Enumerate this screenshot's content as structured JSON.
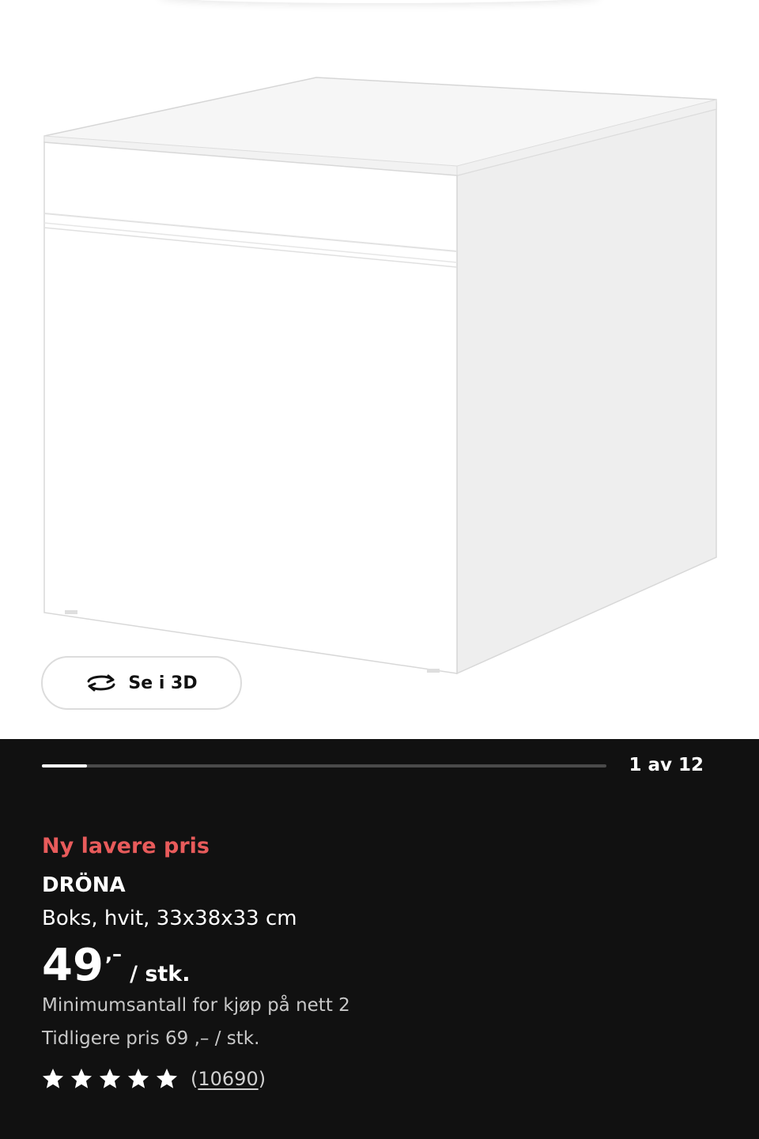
{
  "gallery": {
    "view_3d_label": "Se i 3D",
    "view_3d_icon": "rotate-3d-icon",
    "counter": "1 av 12",
    "progress": 0.08
  },
  "product": {
    "badge": "Ny lavere pris",
    "badge_color": "#e85b5b",
    "name": "DRÖNA",
    "description": "Boks, hvit, 33x38x33 cm",
    "price_integer": "49",
    "price_decimal": ",–",
    "price_unit": "/ stk.",
    "min_quantity": "Minimumsantall for kjøp på nett 2",
    "previous_price": "Tidligere pris 69 ,– / stk.",
    "rating": 5,
    "rating_max": 5,
    "review_open": "(",
    "review_count": "10690",
    "review_close": ")"
  },
  "colors": {
    "panel_background": "#111111",
    "accent": "#e85b5b"
  }
}
